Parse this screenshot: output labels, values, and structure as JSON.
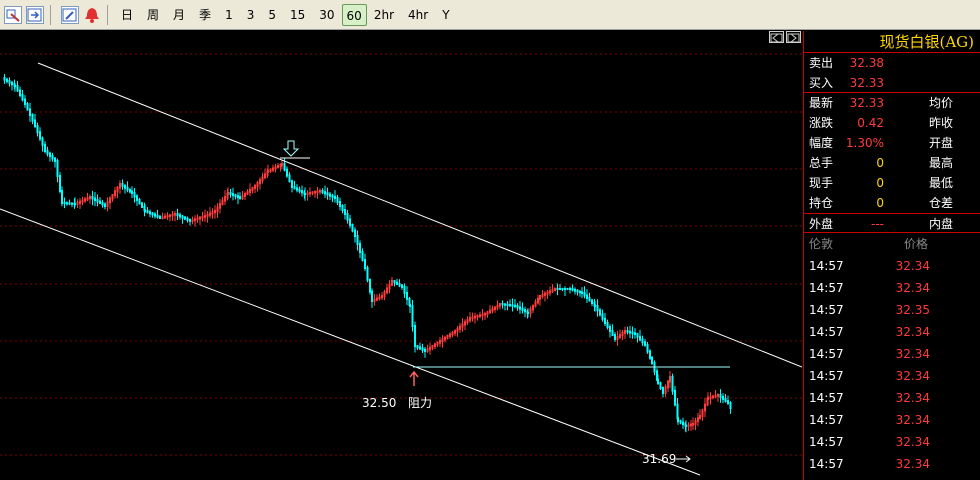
{
  "toolbar": {
    "icons": [
      "chart-switch-icon",
      "export-icon",
      "draw-pen-icon",
      "alarm-bell-icon"
    ],
    "periods": [
      "日",
      "周",
      "月",
      "季",
      "1",
      "3",
      "5",
      "15",
      "30",
      "60",
      "2hr",
      "4hr",
      "Y"
    ],
    "active_period": "60"
  },
  "panel": {
    "title": "现货白银(AG)",
    "sell_label": "卖出",
    "sell_value": "32.38",
    "buy_label": "买入",
    "buy_value": "32.33",
    "rows": [
      {
        "label": "最新",
        "value": "32.33",
        "label2": "均价",
        "color": "red"
      },
      {
        "label": "涨跌",
        "value": "0.42",
        "label2": "昨收",
        "color": "red"
      },
      {
        "label": "幅度",
        "value": "1.30%",
        "label2": "开盘",
        "color": "red"
      },
      {
        "label": "总手",
        "value": "0",
        "label2": "最高",
        "color": "yellow"
      },
      {
        "label": "现手",
        "value": "0",
        "label2": "最低",
        "color": "yellow"
      },
      {
        "label": "持仓",
        "value": "0",
        "label2": "仓差",
        "color": "yellow"
      }
    ],
    "outer_label": "外盘",
    "outer_value": "---",
    "inner_label": "内盘",
    "tick_header": {
      "time": "伦敦",
      "price": "价格"
    },
    "ticks": [
      {
        "time": "14:57",
        "price": "32.34"
      },
      {
        "time": "14:57",
        "price": "32.34"
      },
      {
        "time": "14:57",
        "price": "32.35"
      },
      {
        "time": "14:57",
        "price": "32.34"
      },
      {
        "time": "14:57",
        "price": "32.34"
      },
      {
        "time": "14:57",
        "price": "32.34"
      },
      {
        "time": "14:57",
        "price": "32.34"
      },
      {
        "time": "14:57",
        "price": "32.34"
      },
      {
        "time": "14:57",
        "price": "32.34"
      },
      {
        "time": "14:57",
        "price": "32.34"
      }
    ]
  },
  "annotations": {
    "resistance_price": "32.50",
    "resistance_label": "阻力",
    "low_label": "31.69"
  },
  "colors": {
    "up": "#ff3b3b",
    "down": "#00ffff",
    "channel": "#ffffff",
    "grid": "#800000"
  }
}
